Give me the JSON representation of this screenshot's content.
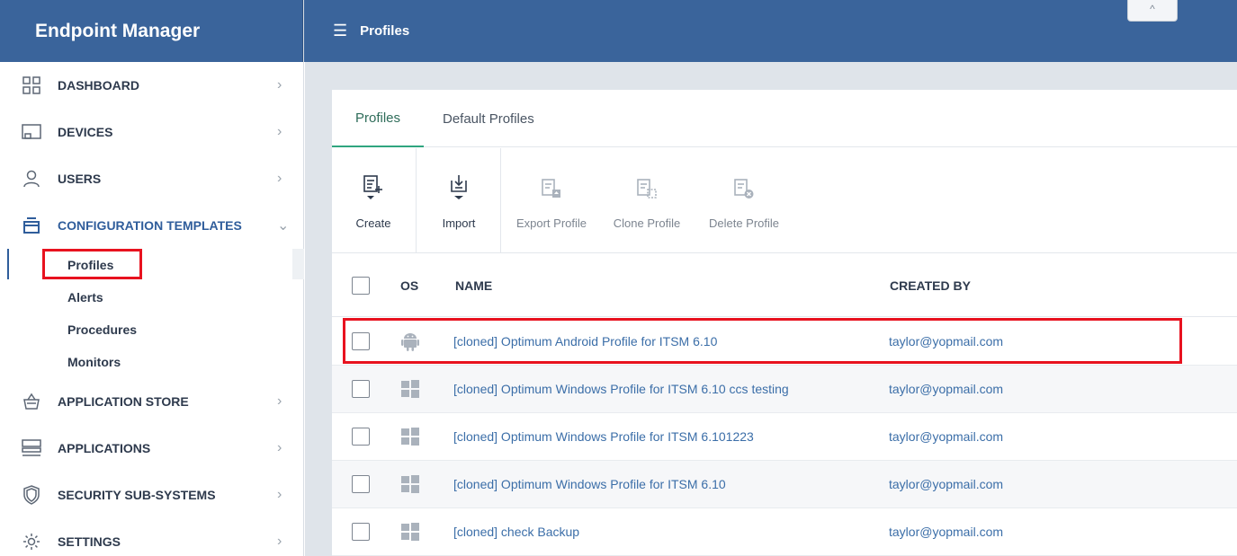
{
  "app": {
    "brand": "Endpoint Manager"
  },
  "header": {
    "menu_icon": "hamburger-icon",
    "title": "Profiles",
    "collapse_glyph": "^"
  },
  "sidebar": {
    "items": [
      {
        "label": "DASHBOARD",
        "icon": "dashboard-icon",
        "chevron": "›"
      },
      {
        "label": "DEVICES",
        "icon": "devices-icon",
        "chevron": "›"
      },
      {
        "label": "USERS",
        "icon": "user-icon",
        "chevron": "›"
      },
      {
        "label": "CONFIGURATION TEMPLATES",
        "icon": "templates-icon",
        "chevron": "⌄",
        "expanded": true
      },
      {
        "label": "APPLICATION STORE",
        "icon": "store-icon",
        "chevron": "›"
      },
      {
        "label": "APPLICATIONS",
        "icon": "applications-icon",
        "chevron": "›"
      },
      {
        "label": "SECURITY SUB-SYSTEMS",
        "icon": "shield-icon",
        "chevron": "›"
      },
      {
        "label": "SETTINGS",
        "icon": "gear-icon",
        "chevron": "›"
      }
    ],
    "subitems": [
      {
        "label": "Profiles",
        "selected": true
      },
      {
        "label": "Alerts"
      },
      {
        "label": "Procedures"
      },
      {
        "label": "Monitors"
      }
    ]
  },
  "tabs": [
    {
      "label": "Profiles",
      "active": true
    },
    {
      "label": "Default Profiles"
    }
  ],
  "toolbar": {
    "create": "Create",
    "import": "Import",
    "export": "Export Profile",
    "clone": "Clone Profile",
    "delete": "Delete Profile"
  },
  "table": {
    "headers": {
      "os": "OS",
      "name": "NAME",
      "created_by": "CREATED BY"
    },
    "rows": [
      {
        "os": "android",
        "name": "[cloned] Optimum Android Profile for ITSM 6.10",
        "created_by": "taylor@yopmail.com"
      },
      {
        "os": "windows",
        "name": "[cloned] Optimum Windows Profile for ITSM 6.10 ccs testing",
        "created_by": "taylor@yopmail.com"
      },
      {
        "os": "windows",
        "name": "[cloned] Optimum Windows Profile for ITSM 6.101223",
        "created_by": "taylor@yopmail.com"
      },
      {
        "os": "windows",
        "name": "[cloned] Optimum Windows Profile for ITSM 6.10",
        "created_by": "taylor@yopmail.com"
      },
      {
        "os": "windows",
        "name": "[cloned] check Backup",
        "created_by": "taylor@yopmail.com"
      }
    ]
  },
  "colors": {
    "header_bg": "#3a649b",
    "accent_tab": "#2fa57f",
    "link": "#3b6ea8",
    "highlight": "#e8121f"
  }
}
